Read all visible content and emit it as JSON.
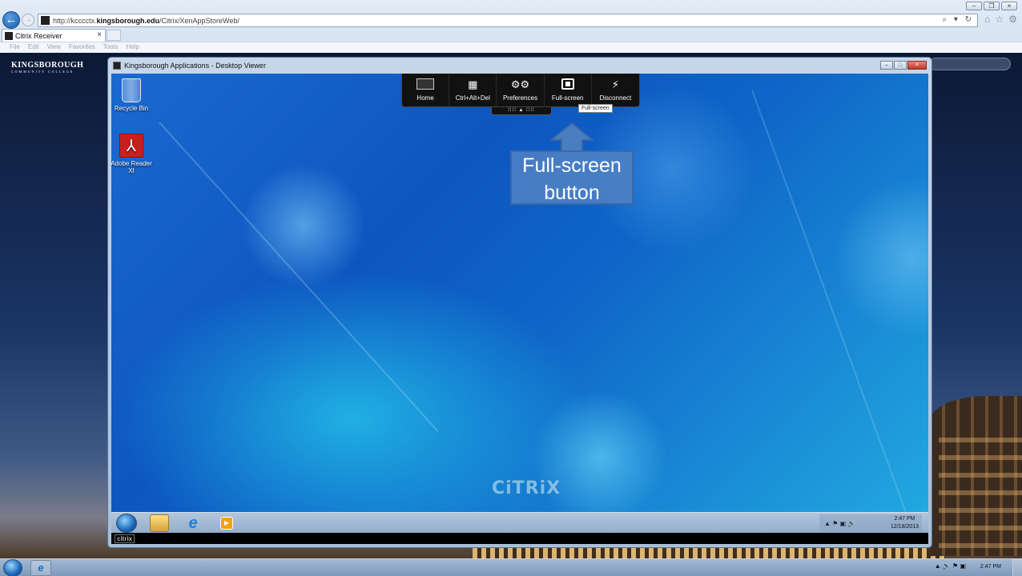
{
  "browser": {
    "url_prefix": "http://kcccctx.",
    "url_domain": "kingsborough.edu",
    "url_path": "/Citrix/XenAppStoreWeb/",
    "address_tools": "⌕ ▾ ↻",
    "right_icons": [
      "⌂",
      "☆",
      "⚙"
    ],
    "back_glyph": "←",
    "fwd_glyph": "→",
    "tab_label": "Citrix Receiver",
    "tab_close": "×",
    "window_controls": [
      "–",
      "❐",
      "×"
    ],
    "menu": [
      "File",
      "Edit",
      "View",
      "Favorites",
      "Tools",
      "Help"
    ]
  },
  "page": {
    "logo_main": "KINGSBOROUGH",
    "logo_sub": "COMMUNITY COLLEGE"
  },
  "viewer": {
    "title": "Kingsborough Applications - Desktop Viewer",
    "controls": [
      "–",
      "□",
      "×"
    ]
  },
  "desktop": {
    "icons": [
      {
        "label": "Recycle Bin",
        "icon": "recycle-bin-icon"
      },
      {
        "label": "Adobe Reader XI",
        "icon": "adobe-reader-icon"
      }
    ],
    "adobe_glyph": "⅄",
    "watermark": "CiTRiX"
  },
  "toolbar": {
    "items": [
      {
        "label": "Home",
        "glyph": ""
      },
      {
        "label": "Ctrl+Alt+Del",
        "glyph": "▦"
      },
      {
        "label": "Preferences",
        "glyph": "⚙⚙"
      },
      {
        "label": "Full-screen",
        "glyph": ""
      },
      {
        "label": "Disconnect",
        "glyph": "⚡"
      }
    ],
    "handle": "⁞⁞⁞⁞ ▲ ⁞⁞⁞⁞",
    "tooltip": "Full-screen"
  },
  "callout": {
    "text": "Full-screen\nbutton",
    "color": "#4f7fbf"
  },
  "remote_taskbar": {
    "ie_glyph": "e",
    "media_glyph": "▶",
    "tray_icons": "▲  ⚑  ▣  🔊",
    "time": "2:47 PM",
    "date": "12/18/2013",
    "citrix_label": "citrix"
  },
  "host_taskbar": {
    "ie_glyph": "e",
    "tray_icons": "▲  🔊  ⚑  ▣",
    "time": "2:47 PM"
  }
}
